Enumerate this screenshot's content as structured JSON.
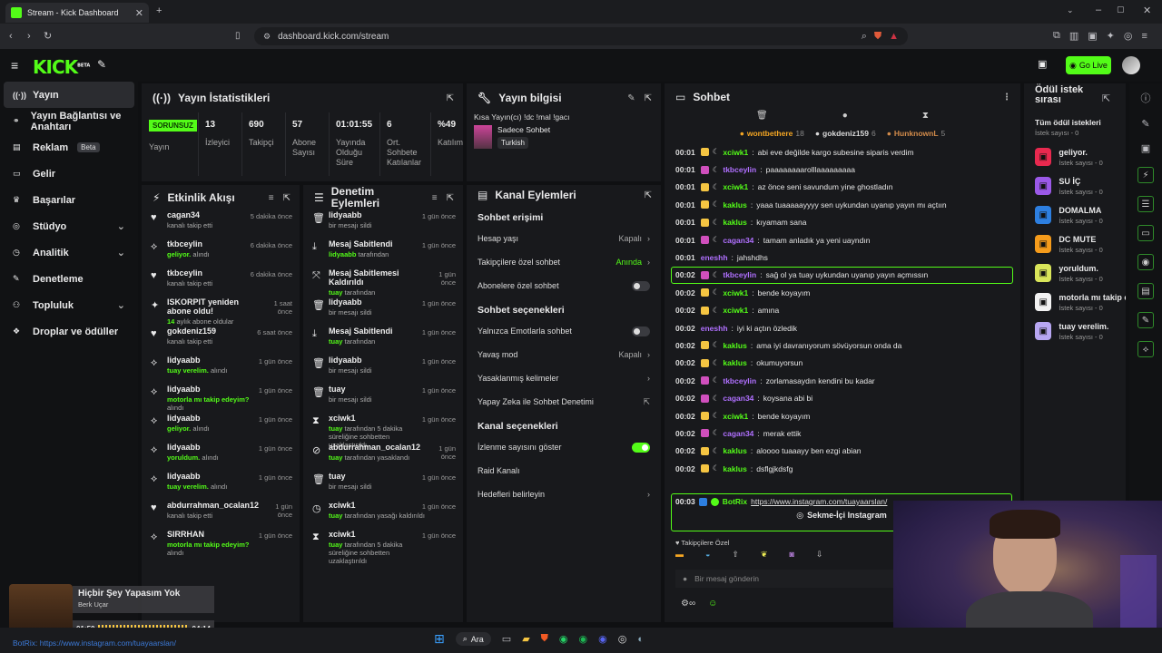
{
  "browser": {
    "tab_title": "Stream - Kick Dashboard",
    "url": "dashboard.kick.com/stream"
  },
  "header": {
    "logo": "KICK",
    "beta": "BETA",
    "go_live": "Go Live"
  },
  "sidebar": {
    "items": [
      {
        "label": "Yayın",
        "icon": "stream-icon",
        "active": true
      },
      {
        "label": "Yayın Bağlantısı ve Anahtarı",
        "icon": "link-icon"
      },
      {
        "label": "Reklam",
        "icon": "ad-icon",
        "badge": "Beta"
      },
      {
        "label": "Gelir",
        "icon": "money-icon"
      },
      {
        "label": "Başarılar",
        "icon": "trophy-icon"
      },
      {
        "label": "Stüdyo",
        "icon": "studio-icon",
        "chevron": true
      },
      {
        "label": "Analitik",
        "icon": "chart-icon",
        "chevron": true
      },
      {
        "label": "Denetleme",
        "icon": "wrench-icon"
      },
      {
        "label": "Topluluk",
        "icon": "community-icon",
        "chevron": true
      },
      {
        "label": "Droplar ve ödüller",
        "icon": "gift-icon"
      }
    ]
  },
  "stats": {
    "title": "Yayın İstatistikleri",
    "status": "SORUNSUZ",
    "status_label": "Yayın",
    "items": [
      {
        "value": "13",
        "label": "İzleyici"
      },
      {
        "value": "690",
        "label": "Takipçi"
      },
      {
        "value": "57",
        "label": "Abone Sayısı"
      },
      {
        "value": "01:01:55",
        "label": "Yayında Olduğu Süre"
      },
      {
        "value": "6",
        "label": "Ort. Sohbete Katılanlar"
      },
      {
        "value": "%49",
        "label": "Katılım"
      }
    ]
  },
  "info": {
    "title": "Yayın bilgisi",
    "stream_title": "Kısa Yayın(cı) !dc !mal !gacı",
    "category": "Sadece Sohbet",
    "language": "Turkish"
  },
  "activity": {
    "title": "Etkinlik Akışı",
    "rows": [
      {
        "icon": "heart-icon",
        "name": "cagan34",
        "sub": "kanalı takip etti",
        "hl": "",
        "time": "5 dakika önce"
      },
      {
        "icon": "reward-icon",
        "name": "tkbceylin",
        "sub": "alındı",
        "hl": "geliyor.",
        "time": "6 dakika önce"
      },
      {
        "icon": "heart-icon",
        "name": "tkbceylin",
        "sub": "kanalı takip etti",
        "hl": "",
        "time": "6 dakika önce"
      },
      {
        "icon": "sparkle-icon",
        "name": "ISKORPIT yeniden abone oldu!",
        "sub": "aylık abone oldular",
        "hl": "14",
        "time": "1 saat önce"
      },
      {
        "icon": "heart-icon",
        "name": "gokdeniz159",
        "sub": "kanalı takip etti",
        "hl": "",
        "time": "6 saat önce"
      },
      {
        "icon": "reward-icon",
        "name": "lidyaabb",
        "sub": "alındı",
        "hl": "tuay verelim.",
        "time": "1 gün önce"
      },
      {
        "icon": "reward-icon",
        "name": "lidyaabb",
        "sub": "alındı",
        "hl": "motorla mı takip edeyim?",
        "time": "1 gün önce"
      },
      {
        "icon": "reward-icon",
        "name": "lidyaabb",
        "sub": "alındı",
        "hl": "geliyor.",
        "time": "1 gün önce"
      },
      {
        "icon": "reward-icon",
        "name": "lidyaabb",
        "sub": "alındı",
        "hl": "yoruldum.",
        "time": "1 gün önce"
      },
      {
        "icon": "reward-icon",
        "name": "lidyaabb",
        "sub": "alındı",
        "hl": "tuay verelim.",
        "time": "1 gün önce"
      },
      {
        "icon": "heart-icon",
        "name": "abdurrahman_ocalan12",
        "sub": "kanalı takip etti",
        "hl": "",
        "time": "1 gün önce"
      },
      {
        "icon": "reward-icon",
        "name": "SIRRHAN",
        "sub": "alındı",
        "hl": "motorla mı takip edeyim?",
        "time": "1 gün önce"
      }
    ]
  },
  "moderation": {
    "title": "Denetim Eylemleri",
    "rows": [
      {
        "icon": "trash-icon",
        "name": "lidyaabb",
        "sub": "bir mesajı sildi",
        "hl": "",
        "time": "1 gün önce"
      },
      {
        "icon": "pin-icon",
        "name": "Mesaj Sabitlendi",
        "sub": "tarafından",
        "hl": "lidyaabb",
        "time": "1 gün önce"
      },
      {
        "icon": "unpin-icon",
        "name": "Mesaj Sabitlemesi Kaldırıldı",
        "sub": "tarafından",
        "hl": "tuay",
        "time": "1 gün önce"
      },
      {
        "icon": "trash-icon",
        "name": "lidyaabb",
        "sub": "bir mesajı sildi",
        "hl": "",
        "time": "1 gün önce"
      },
      {
        "icon": "pin-icon",
        "name": "Mesaj Sabitlendi",
        "sub": "tarafından",
        "hl": "tuay",
        "time": "1 gün önce"
      },
      {
        "icon": "trash-icon",
        "name": "lidyaabb",
        "sub": "bir mesajı sildi",
        "hl": "",
        "time": "1 gün önce"
      },
      {
        "icon": "trash-icon",
        "name": "tuay",
        "sub": "bir mesajı sildi",
        "hl": "",
        "time": "1 gün önce"
      },
      {
        "icon": "hourglass-icon",
        "name": "xciwk1",
        "sub": "tarafından 5 dakika süreliğine sohbetten uzaklaştırıldı",
        "hl": "tuay",
        "time": "1 gün önce"
      },
      {
        "icon": "ban-icon",
        "name": "abdurrahman_ocalan12",
        "sub": "tarafından yasaklandı",
        "hl": "tuay",
        "time": "1 gün önce"
      },
      {
        "icon": "trash-icon",
        "name": "tuay",
        "sub": "bir mesajı sildi",
        "hl": "",
        "time": "1 gün önce"
      },
      {
        "icon": "clock-icon",
        "name": "xciwk1",
        "sub": "tarafından yasağı kaldırıldı",
        "hl": "tuay",
        "time": "1 gün önce"
      },
      {
        "icon": "hourglass-icon",
        "name": "xciwk1",
        "sub": "tarafından 5 dakika süreliğine sohbetten uzaklaştırıldı",
        "hl": "tuay",
        "time": "1 gün önce"
      }
    ]
  },
  "channel": {
    "title": "Kanal Eylemleri",
    "chat_access": "Sohbet erişimi",
    "chat_options": "Sohbet seçenekleri",
    "channel_options": "Kanal seçenekleri",
    "access": [
      {
        "label": "Hesap yaşı",
        "value": "Kapalı",
        "ctl": "chevron"
      },
      {
        "label": "Takipçilere özel sohbet",
        "value": "Anında",
        "ctl": "chevron",
        "green": true
      },
      {
        "label": "Abonelere özel sohbet",
        "value": "",
        "ctl": "toggle",
        "on": false
      }
    ],
    "options": [
      {
        "label": "Yalnızca Emotlarla sohbet",
        "value": "",
        "ctl": "toggle",
        "on": false
      },
      {
        "label": "Yavaş mod",
        "value": "Kapalı",
        "ctl": "chevron"
      },
      {
        "label": "Yasaklanmış kelimeler",
        "value": "",
        "ctl": "chevron"
      },
      {
        "label": "Yapay Zeka ile Sohbet Denetimi",
        "value": "",
        "ctl": "external"
      }
    ],
    "chan": [
      {
        "label": "İzlenme sayısını göster",
        "value": "",
        "ctl": "toggle",
        "on": true
      },
      {
        "label": "Raid Kanalı",
        "value": "",
        "ctl": "none"
      },
      {
        "label": "Hedefleri belirleyin",
        "value": "",
        "ctl": "chevron"
      }
    ]
  },
  "chat": {
    "title": "Sohbet",
    "top": [
      {
        "name": "wontbethere",
        "n": "18",
        "color": "#f5a623"
      },
      {
        "name": "gokdeniz159",
        "n": "6",
        "color": "#d9d9d9"
      },
      {
        "name": "HunknownL",
        "n": "5",
        "color": "#d28b4a"
      }
    ],
    "messages": [
      {
        "t": "00:01",
        "u": "xciwk1",
        "c": "#53fc18",
        "m": "abi eve değilde kargo subesine siparis verdim"
      },
      {
        "t": "00:01",
        "u": "tkbceylin",
        "c": "#b070ff",
        "m": "paaaaaaaarolllaaaaaaaaa"
      },
      {
        "t": "00:01",
        "u": "xciwk1",
        "c": "#53fc18",
        "m": "az önce seni savundum yine ghostladın"
      },
      {
        "t": "00:01",
        "u": "kaklus",
        "c": "#53fc18",
        "m": "yaaa tuaaaaayyyy sen uykundan uyanıp yayın mı açtıın"
      },
      {
        "t": "00:01",
        "u": "kaklus",
        "c": "#53fc18",
        "m": "kıyamam sana"
      },
      {
        "t": "00:01",
        "u": "cagan34",
        "c": "#b070ff",
        "m": "tamam anladık ya yeni uayndın"
      },
      {
        "t": "00:01",
        "u": "eneshh",
        "c": "#b070ff",
        "m": "jahshdhs"
      },
      {
        "t": "00:02",
        "u": "tkbceylin",
        "c": "#b070ff",
        "m": "sağ ol ya tuay uykundan uyanıp yayın açmıssın",
        "hl": true
      },
      {
        "t": "00:02",
        "u": "xciwk1",
        "c": "#53fc18",
        "m": "bende koyayım"
      },
      {
        "t": "00:02",
        "u": "xciwk1",
        "c": "#53fc18",
        "m": "amına"
      },
      {
        "t": "00:02",
        "u": "eneshh",
        "c": "#b070ff",
        "m": "iyi ki açtın özledik"
      },
      {
        "t": "00:02",
        "u": "kaklus",
        "c": "#53fc18",
        "m": "ama iyi davranıyorum sövüyorsun onda da"
      },
      {
        "t": "00:02",
        "u": "kaklus",
        "c": "#53fc18",
        "m": "okumuyorsun"
      },
      {
        "t": "00:02",
        "u": "tkbceylin",
        "c": "#b070ff",
        "m": "zorlamasaydın kendini bu kadar"
      },
      {
        "t": "00:02",
        "u": "cagan34",
        "c": "#b070ff",
        "m": "koysana abi bi"
      },
      {
        "t": "00:02",
        "u": "xciwk1",
        "c": "#53fc18",
        "m": "bende koyayım"
      },
      {
        "t": "00:02",
        "u": "cagan34",
        "c": "#b070ff",
        "m": "merak ettik"
      },
      {
        "t": "00:02",
        "u": "kaklus",
        "c": "#53fc18",
        "m": "aloooo tuaaayy ben ezgi abian"
      },
      {
        "t": "00:02",
        "u": "kaklus",
        "c": "#53fc18",
        "m": "dsflgjkdsfg"
      }
    ],
    "bot": {
      "t": "00:03",
      "u": "BotRix",
      "m": "https://www.instagram.com/tuayaarslan/",
      "btn": "Sekme-İçi Instagram"
    },
    "follower_only": "Takipçilere Özel",
    "placeholder": "Bir mesaj gönderin"
  },
  "rewards": {
    "title": "Ödül istek sırası",
    "subtitle": "Tüm ödül istekleri",
    "count_label": "İstek sayısı - 0",
    "items": [
      {
        "name": "geliyor.",
        "color": "#e8294f"
      },
      {
        "name": "SU İÇ",
        "color": "#9b59e8"
      },
      {
        "name": "DOMALMA",
        "color": "#2d7fe0"
      },
      {
        "name": "DC MUTE",
        "color": "#f59b1b"
      },
      {
        "name": "yoruldum.",
        "color": "#d9e55a"
      },
      {
        "name": "motorla mı takip ed",
        "color": "#f2f2f2"
      },
      {
        "name": "tuay verelim.",
        "color": "#b7a6f2"
      }
    ]
  },
  "player": {
    "title": "Hiçbir Şey Yapasım Yok",
    "artist": "Berk Uçar",
    "elapsed": "01:50",
    "total": "04:14",
    "ticker": "BotRix: https://www.instagram.com/tuayaarslan/"
  },
  "taskbar": {
    "search": "Ara"
  }
}
